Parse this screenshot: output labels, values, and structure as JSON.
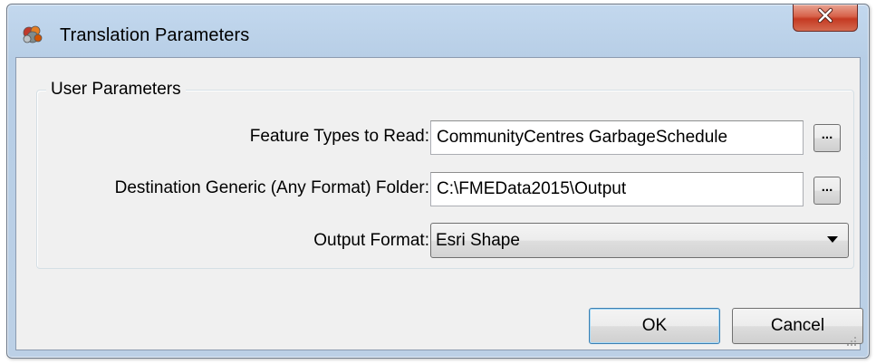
{
  "window": {
    "title": "Translation Parameters",
    "app_icon": "fme-workbench-icon",
    "close_icon": "close-icon",
    "close_glyph": "X"
  },
  "group": {
    "label": "User Parameters"
  },
  "fields": [
    {
      "label": "Feature Types to Read:",
      "value": "CommunityCentres GarbageSchedule",
      "browse_label": "..."
    },
    {
      "label": "Destination Generic (Any Format) Folder:",
      "value": "C:\\FMEData2015\\Output",
      "browse_label": "..."
    }
  ],
  "output_format": {
    "label": "Output Format:",
    "selected": "Esri Shape"
  },
  "buttons": {
    "ok": "OK",
    "cancel": "Cancel"
  },
  "colors": {
    "title_bar": "#b9cfe7",
    "close_button": "#c9452c",
    "client_bg": "#f0f0f0",
    "default_button_border": "#3c7fb1"
  }
}
